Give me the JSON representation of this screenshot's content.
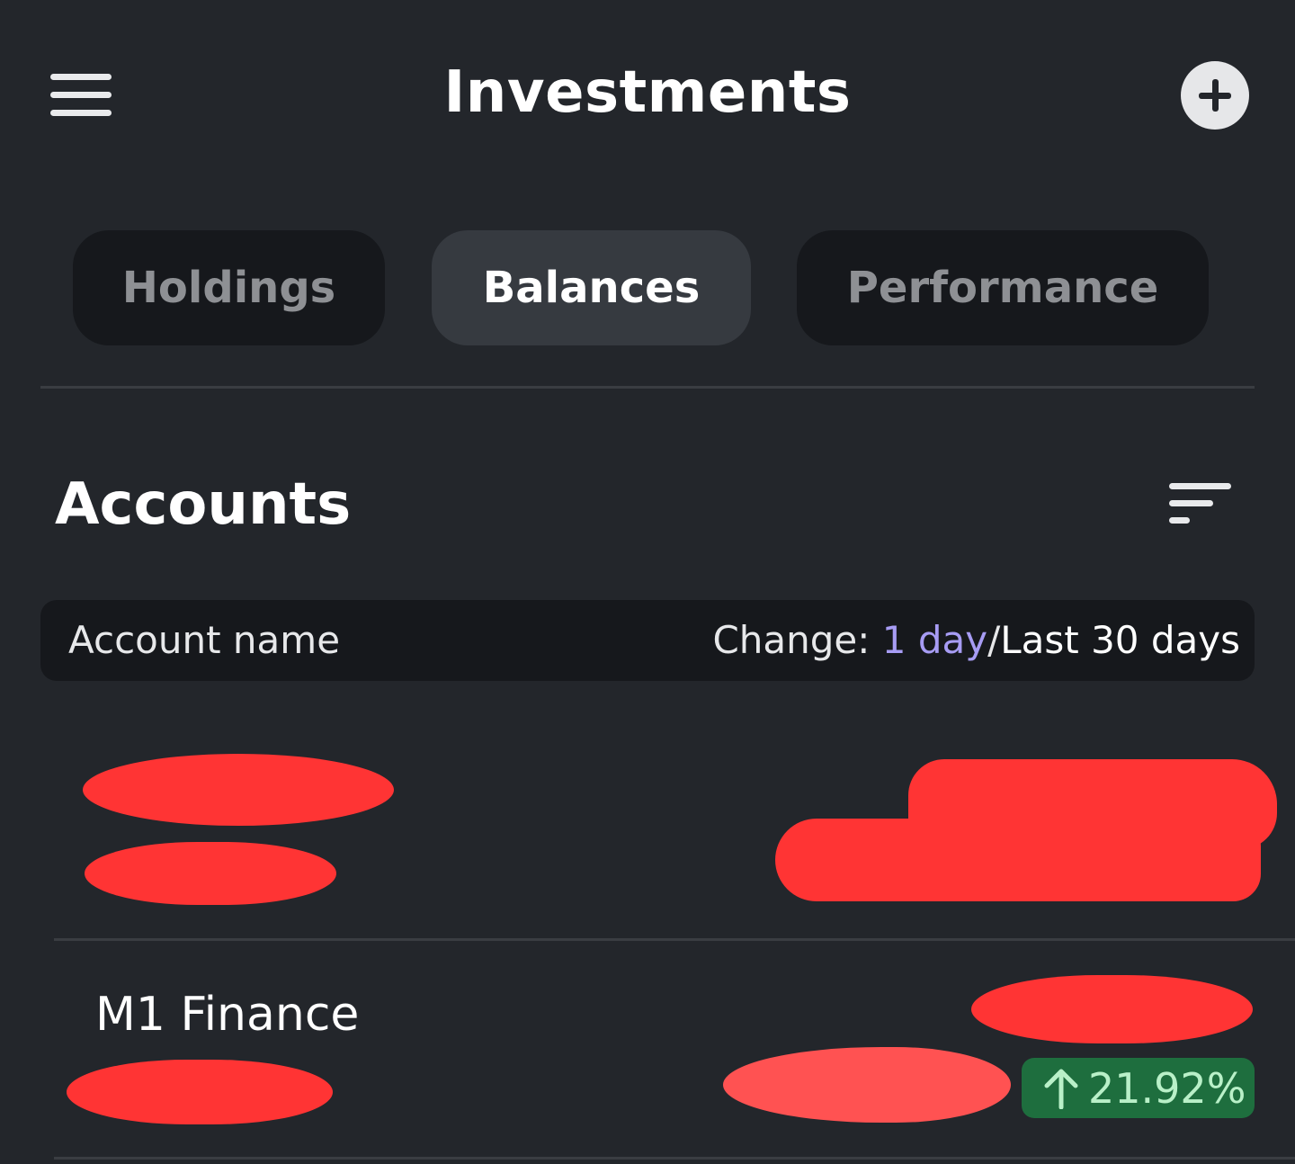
{
  "header": {
    "title": "Investments",
    "menu_icon": "hamburger-menu-icon",
    "add_icon": "plus-circle-icon"
  },
  "tabs": [
    {
      "label": "Holdings",
      "active": false
    },
    {
      "label": "Balances",
      "active": true
    },
    {
      "label": "Performance",
      "active": false
    }
  ],
  "accounts": {
    "title": "Accounts",
    "sort_icon": "sort-lines-icon",
    "columns": {
      "name_label": "Account name",
      "change_prefix": "Change: ",
      "change_selected": "1 day",
      "change_separator": "/",
      "change_alternate": "Last 30 days"
    },
    "rows": [
      {
        "name": "",
        "redacted": true
      },
      {
        "name": "M1 Finance",
        "redacted_details": true,
        "change_percent": "21.92%",
        "change_direction": "up"
      }
    ]
  },
  "colors": {
    "background": "#23262b",
    "tab_inactive": "#16181c",
    "tab_active": "#363a40",
    "accent": "#a79cf4",
    "positive_badge": "#1e6e3e",
    "positive_text": "#b9f0c8",
    "redaction": "#ff3434"
  }
}
